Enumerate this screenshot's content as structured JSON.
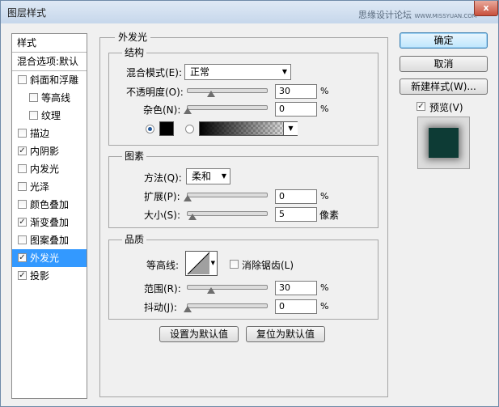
{
  "window": {
    "title": "图层样式",
    "close_glyph": "x"
  },
  "watermark": {
    "text": "思缘设计论坛",
    "url": "WWW.MISSYUAN.COM"
  },
  "sidebar": {
    "header": "样式",
    "blend_options": "混合选项:默认",
    "items": [
      {
        "label": "斜面和浮雕",
        "checked": false
      },
      {
        "label": "等高线",
        "checked": false
      },
      {
        "label": "纹理",
        "checked": false
      },
      {
        "label": "描边",
        "checked": false
      },
      {
        "label": "内阴影",
        "checked": true
      },
      {
        "label": "内发光",
        "checked": false
      },
      {
        "label": "光泽",
        "checked": false
      },
      {
        "label": "颜色叠加",
        "checked": false
      },
      {
        "label": "渐变叠加",
        "checked": true
      },
      {
        "label": "图案叠加",
        "checked": false
      },
      {
        "label": "外发光",
        "checked": true,
        "selected": true
      },
      {
        "label": "投影",
        "checked": true
      }
    ]
  },
  "panel": {
    "title": "外发光",
    "structure": {
      "title": "结构",
      "blend_mode_label": "混合模式(E):",
      "blend_mode_value": "正常",
      "opacity_label": "不透明度(O):",
      "opacity_value": "30",
      "opacity_level": 30,
      "noise_label": "杂色(N):",
      "noise_value": "0",
      "noise_level": 0,
      "percent": "%"
    },
    "elements": {
      "title": "图素",
      "method_label": "方法(Q):",
      "method_value": "柔和",
      "spread_label": "扩展(P):",
      "spread_value": "0",
      "spread_level": 0,
      "size_label": "大小(S):",
      "size_value": "5",
      "size_unit": "像素",
      "percent": "%"
    },
    "quality": {
      "title": "品质",
      "contour_label": "等高线:",
      "antialias_label": "消除锯齿(L)",
      "range_label": "范围(R):",
      "range_value": "30",
      "range_level": 30,
      "jitter_label": "抖动(J):",
      "jitter_value": "0",
      "jitter_level": 0,
      "percent": "%"
    },
    "set_default": "设置为默认值",
    "reset_default": "复位为默认值"
  },
  "buttons": {
    "ok": "确定",
    "cancel": "取消",
    "new_style": "新建样式(W)...",
    "preview": "预览(V)"
  },
  "colors": {
    "glow_color": "#000000",
    "preview_fill": "#0d3b35",
    "accent": "#3399ff"
  }
}
